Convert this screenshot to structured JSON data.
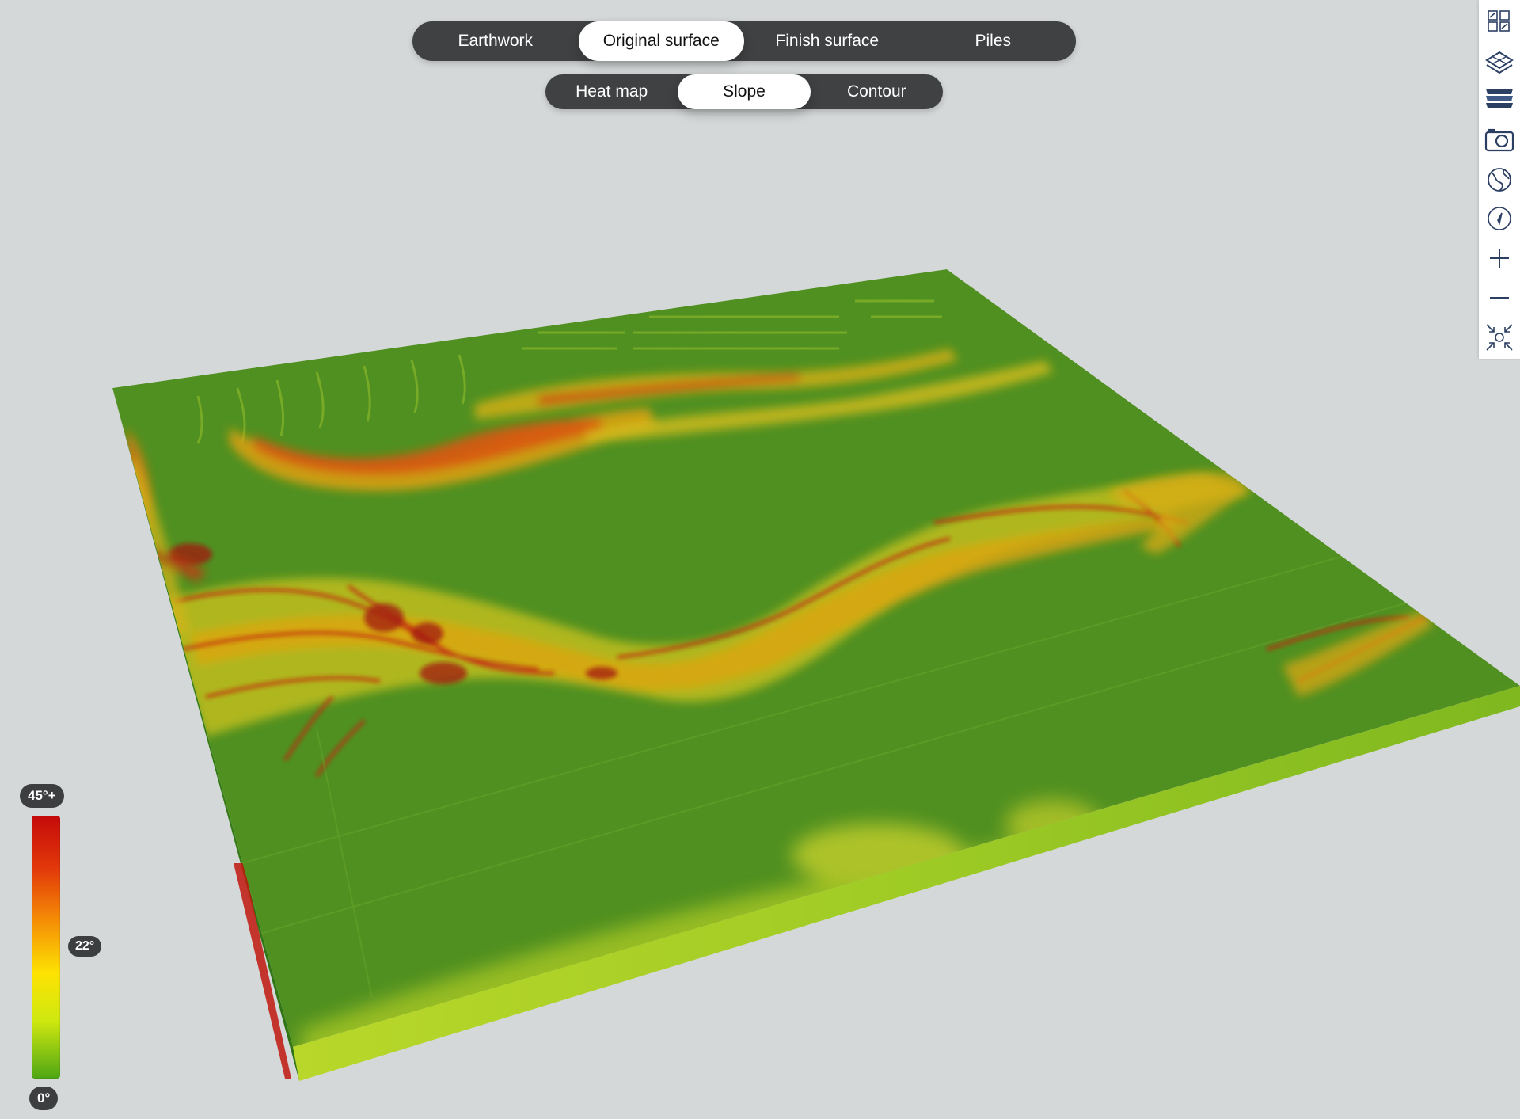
{
  "mode_tabs": [
    {
      "label": "Earthwork",
      "active": false
    },
    {
      "label": "Original surface",
      "active": true
    },
    {
      "label": "Finish surface",
      "active": false
    },
    {
      "label": "Piles",
      "active": false
    }
  ],
  "view_tabs": [
    {
      "label": "Heat map",
      "active": false
    },
    {
      "label": "Slope",
      "active": true
    },
    {
      "label": "Contour",
      "active": false
    }
  ],
  "toolbar": [
    {
      "icon": "layout-grid-icon"
    },
    {
      "icon": "map-layers-3d-icon"
    },
    {
      "icon": "stacked-layers-icon"
    },
    {
      "icon": "camera-icon"
    },
    {
      "icon": "globe-icon"
    },
    {
      "icon": "compass-icon"
    },
    {
      "icon": "zoom-in-icon"
    },
    {
      "icon": "zoom-out-icon"
    },
    {
      "icon": "reset-view-icon"
    }
  ],
  "legend": {
    "max_label": "45°+",
    "mid_label": "22°",
    "min_label": "0°",
    "colors": [
      "#c40a0a",
      "#f58e06",
      "#fde303",
      "#4ea614"
    ]
  },
  "colors": {
    "background": "#d5d8d9",
    "terrain_base": "#4c8e1d",
    "terrain_edge": "#a8d12a",
    "steep": "#d11f0a",
    "moderate": "#f2c20a"
  }
}
